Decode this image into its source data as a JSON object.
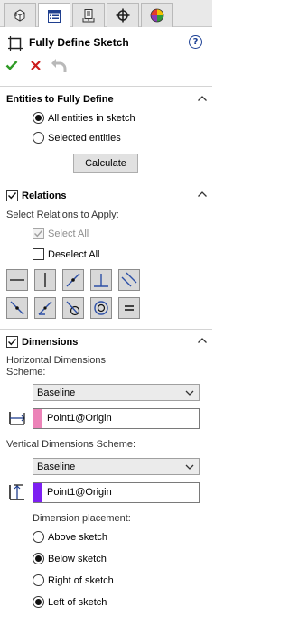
{
  "tabs": [
    {
      "icon": "feature-manager-tree-icon",
      "active": false
    },
    {
      "icon": "property-manager-icon",
      "active": true
    },
    {
      "icon": "configuration-manager-icon",
      "active": false
    },
    {
      "icon": "dimxpert-manager-icon",
      "active": false
    },
    {
      "icon": "display-manager-icon",
      "active": false
    }
  ],
  "header": {
    "title": "Fully Define Sketch",
    "help": "?"
  },
  "entities": {
    "title": "Entities to Fully Define",
    "options": [
      "All entities in sketch",
      "Selected entities"
    ],
    "selected": 0,
    "calculate_label": "Calculate"
  },
  "relations": {
    "title": "Relations",
    "checked": true,
    "apply_label": "Select Relations to Apply:",
    "select_all": "Select All",
    "deselect_all": "Deselect All",
    "buttons": [
      "horizontal",
      "vertical",
      "midpoint",
      "coincident",
      "parallel",
      "perpendicular",
      "tangent",
      "concentric",
      "equal",
      "colinear",
      "fix"
    ]
  },
  "dimensions": {
    "title": "Dimensions",
    "checked": true,
    "horizontal_label_1": "Horizontal Dimensions",
    "horizontal_label_2": "Scheme:",
    "horizontal_scheme": "Baseline",
    "horizontal_datum": "Point1@Origin",
    "horizontal_color": "#ec83b8",
    "vertical_label": "Vertical Dimensions Scheme:",
    "vertical_scheme": "Baseline",
    "vertical_datum": "Point1@Origin",
    "vertical_color": "#7d1ff2",
    "placement_label": "Dimension placement:",
    "placement_options": [
      "Above sketch",
      "Below sketch",
      "Right of sketch",
      "Left of sketch"
    ],
    "placement_selected": [
      1,
      3
    ]
  }
}
